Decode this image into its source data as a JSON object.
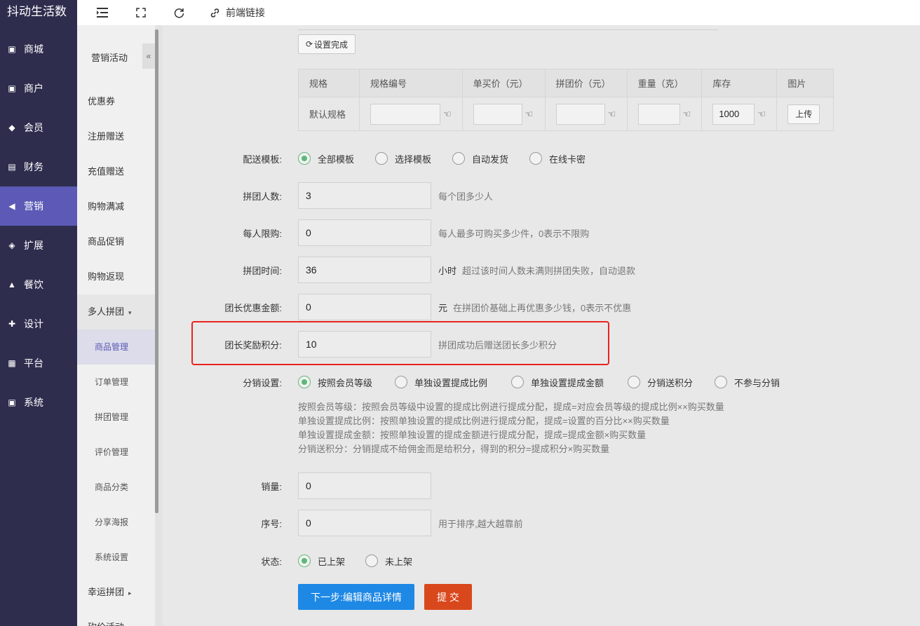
{
  "app": {
    "brand": "抖动生活数"
  },
  "nav": {
    "items": [
      {
        "label": "商城",
        "icon": "shop-icon"
      },
      {
        "label": "商户",
        "icon": "merchant-icon"
      },
      {
        "label": "会员",
        "icon": "member-icon"
      },
      {
        "label": "财务",
        "icon": "finance-icon"
      },
      {
        "label": "营销",
        "icon": "megaphone-icon",
        "active": true
      },
      {
        "label": "扩展",
        "icon": "cube-icon"
      },
      {
        "label": "餐饮",
        "icon": "dish-icon"
      },
      {
        "label": "设计",
        "icon": "puzzle-icon"
      },
      {
        "label": "平台",
        "icon": "grid-icon"
      },
      {
        "label": "系统",
        "icon": "monitor-icon"
      }
    ]
  },
  "toolbar": {
    "link_label": "前端链接"
  },
  "submenu": {
    "title": "营销活动",
    "collapse": "«",
    "items": [
      "优惠券",
      "注册赠送",
      "充值赠送",
      "购物满减",
      "商品促销",
      "购物返现"
    ],
    "group": {
      "label": "多人拼团",
      "caret": "▾"
    },
    "children": [
      "商品管理",
      "订单管理",
      "拼团管理",
      "评价管理",
      "商品分类",
      "分享海报",
      "系统设置"
    ],
    "next_group": {
      "label": "幸运拼团",
      "caret": "▸"
    },
    "partial": "砍价活动"
  },
  "spec": {
    "done_button": "设置完成",
    "headers": [
      "规格",
      "规格编号",
      "单买价（元）",
      "拼团价（元）",
      "重量（克）",
      "库存",
      "图片"
    ],
    "row": {
      "name": "默认规格",
      "code": "",
      "single_price": "",
      "group_price": "",
      "weight": "",
      "stock": "1000",
      "upload": "上传"
    }
  },
  "form": {
    "delivery": {
      "label": "配送模板:",
      "options": [
        "全部模板",
        "选择模板",
        "自动发货",
        "在线卡密"
      ],
      "selected": 0
    },
    "group_size": {
      "label": "拼团人数:",
      "value": "3",
      "hint": "每个团多少人"
    },
    "limit": {
      "label": "每人限购:",
      "value": "0",
      "hint": "每人最多可购买多少件，0表示不限购"
    },
    "time": {
      "label": "拼团时间:",
      "value": "36",
      "unit": "小时",
      "hint": "超过该时间人数未满则拼团失败，自动退款"
    },
    "leader_discount": {
      "label": "团长优惠金额:",
      "value": "0",
      "unit": "元",
      "hint": "在拼团价基础上再优惠多少钱，0表示不优惠"
    },
    "leader_points": {
      "label": "团长奖励积分:",
      "value": "10",
      "hint": "拼团成功后赠送团长多少积分"
    },
    "distribution": {
      "label": "分销设置:",
      "options": [
        "按照会员等级",
        "单独设置提成比例",
        "单独设置提成金额",
        "分销送积分",
        "不参与分销"
      ],
      "selected": 0
    },
    "desc": [
      "按照会员等级：按照会员等级中设置的提成比例进行提成分配，提成=对应会员等级的提成比例××购买数量",
      "单独设置提成比例：按照单独设置的提成比例进行提成分配，提成=设置的百分比××购买数量",
      "单独设置提成金额：按照单独设置的提成金额进行提成分配，提成=提成金额×购买数量",
      "分销送积分：分销提成不给佣金而是给积分，得到的积分=提成积分×购买数量"
    ],
    "sales": {
      "label": "销量:",
      "value": "0"
    },
    "sort": {
      "label": "序号:",
      "value": "0",
      "hint": "用于排序,越大越靠前"
    },
    "status": {
      "label": "状态:",
      "options": [
        "已上架",
        "未上架"
      ],
      "selected": 0
    }
  },
  "actions": {
    "next": "下一步:编辑商品详情",
    "submit": "提 交"
  },
  "colors": {
    "nav_bg": "#2e2d4e",
    "nav_active": "#5c5ab6",
    "primary": "#1e88e5",
    "danger": "#d9481d",
    "radio_on": "#5fb878",
    "highlight": "#e8231f"
  }
}
